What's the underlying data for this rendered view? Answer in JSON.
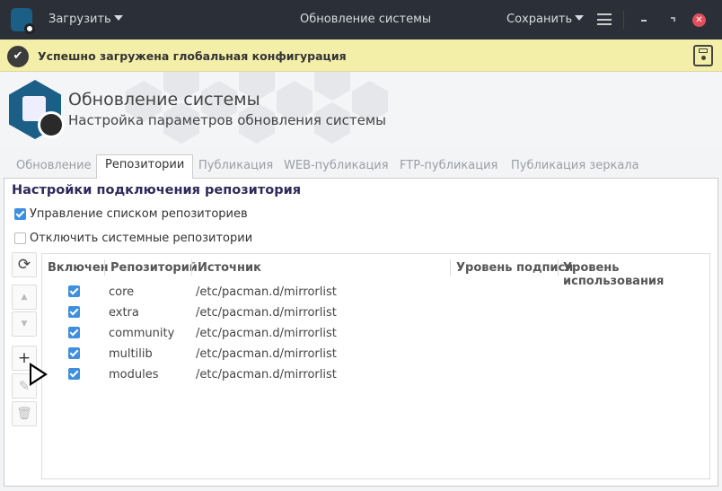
{
  "titlebar": {
    "load_label": "Загрузить",
    "title": "Обновление системы",
    "save_label": "Сохранить",
    "icons": [
      "app-icon",
      "menu-icon",
      "minimize-icon",
      "maximize-icon",
      "close-icon"
    ]
  },
  "banner": {
    "message": "Успешно загружена глобальная конфигурация",
    "icon": "check-circle-icon",
    "save_icon": "floppy-check-icon"
  },
  "header": {
    "title": "Обновление системы",
    "subtitle": "Настройка параметров обновления системы"
  },
  "tabs": [
    {
      "label": "Обновление"
    },
    {
      "label": "Репозитории",
      "active": true
    },
    {
      "label": "Публикация"
    },
    {
      "label": "WEB-публикация"
    },
    {
      "label": "FTP-публикация"
    },
    {
      "label": "Публикация зеркала"
    }
  ],
  "section": {
    "title": "Настройки подключения репозитория",
    "manage_list": {
      "label": "Управление списком репозиториев",
      "checked": true
    },
    "disable_system": {
      "label": "Отключить системные репозитории",
      "checked": false
    }
  },
  "table": {
    "columns": [
      "Включен",
      "Репозиторий",
      "Источник",
      "Уровень подписи",
      "Уровень использования"
    ],
    "rows": [
      {
        "enabled": true,
        "repo": "core",
        "source": "/etc/pacman.d/mirrorlist"
      },
      {
        "enabled": true,
        "repo": "extra",
        "source": "/etc/pacman.d/mirrorlist"
      },
      {
        "enabled": true,
        "repo": "community",
        "source": "/etc/pacman.d/mirrorlist"
      },
      {
        "enabled": true,
        "repo": "multilib",
        "source": "/etc/pacman.d/mirrorlist"
      },
      {
        "enabled": true,
        "repo": "modules",
        "source": "/etc/pacman.d/mirrorlist"
      }
    ]
  },
  "toolbar": [
    "refresh-icon",
    "arrow-up-icon",
    "arrow-down-icon",
    "plus-icon",
    "pencil-icon",
    "trash-icon"
  ],
  "colors": {
    "titlebar": "#2b2f37",
    "banner": "#f3eea8",
    "accent": "#3d8fe0",
    "heading": "#2e2a5a",
    "close": "#e0505a"
  }
}
